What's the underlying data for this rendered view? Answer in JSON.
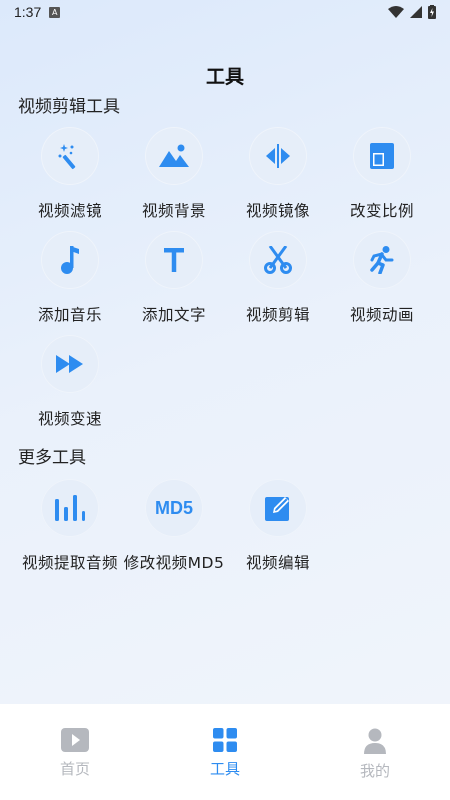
{
  "status_bar": {
    "time": "1:37",
    "notif_letter": "A"
  },
  "header": {
    "title": "工具"
  },
  "sections": {
    "video_edit": {
      "title": "视频剪辑工具",
      "items": [
        {
          "label": "视频滤镜",
          "icon": "magic-wand-icon"
        },
        {
          "label": "视频背景",
          "icon": "image-icon"
        },
        {
          "label": "视频镜像",
          "icon": "mirror-icon"
        },
        {
          "label": "改变比例",
          "icon": "aspect-ratio-icon"
        },
        {
          "label": "添加音乐",
          "icon": "music-note-icon"
        },
        {
          "label": "添加文字",
          "icon": "text-icon"
        },
        {
          "label": "视频剪辑",
          "icon": "scissors-icon"
        },
        {
          "label": "视频动画",
          "icon": "running-icon"
        },
        {
          "label": "视频变速",
          "icon": "fast-forward-icon"
        }
      ]
    },
    "more": {
      "title": "更多工具",
      "items": [
        {
          "label": "视频提取音频",
          "icon": "audio-bars-icon"
        },
        {
          "label": "修改视频MD5",
          "icon": "md5-icon",
          "icon_text": "MD5"
        },
        {
          "label": "视频编辑",
          "icon": "edit-icon"
        }
      ]
    }
  },
  "tabbar": {
    "tabs": [
      {
        "label": "首页",
        "icon": "video-play-icon",
        "active": false
      },
      {
        "label": "工具",
        "icon": "grid-icon",
        "active": true
      },
      {
        "label": "我的",
        "icon": "person-icon",
        "active": false
      }
    ]
  },
  "colors": {
    "accent": "#2e8cf0",
    "icon_bg": "#e6eef9",
    "inactive": "#b5b8be"
  }
}
